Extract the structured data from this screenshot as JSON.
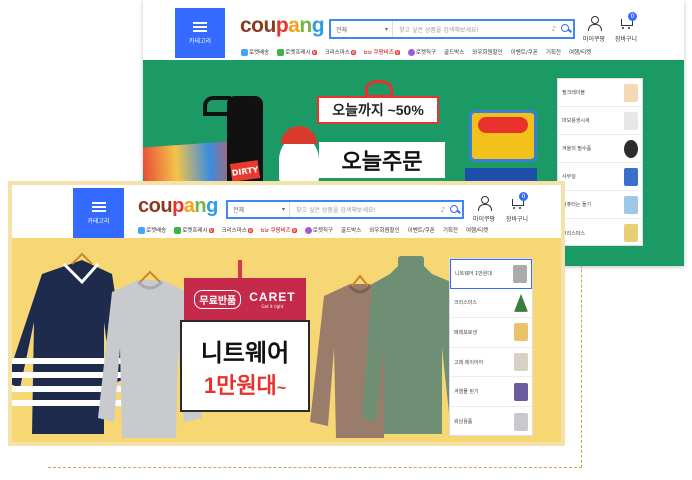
{
  "back": {
    "category_label": "카테고리",
    "logo": [
      "cou",
      "p",
      "a",
      "n",
      "g"
    ],
    "search": {
      "select": "전체",
      "placeholder": "찾고 싶은 상품을 검색해보세요!"
    },
    "mycoupang": "마이쿠팡",
    "cart": {
      "label": "장바구니",
      "count": "0"
    },
    "nav": [
      "로켓배송",
      "로켓프레시",
      "크리스마스",
      "biz 쿠팡비즈",
      "로켓직구",
      "골드박스",
      "와우회원할인",
      "이벤트/쿠폰",
      "기획전",
      "여행/티켓"
    ],
    "promo": {
      "headline": "오늘까지 ~50%",
      "title": "오늘주문"
    },
    "side": [
      "필크레이블",
      "마모용생시세",
      "겨울의 필수품",
      "사무실",
      "컴퓨터는 돌기",
      "크리스마스"
    ]
  },
  "front": {
    "category_label": "카테고리",
    "logo": [
      "cou",
      "p",
      "a",
      "n",
      "g"
    ],
    "search": {
      "select": "전체",
      "placeholder": "찾고 싶은 상품을 검색해보세요!"
    },
    "mycoupang": "마이쿠팡",
    "cart": {
      "label": "장바구니",
      "count": "0"
    },
    "nav": [
      "로켓배송",
      "로켓프레시",
      "크리스마스",
      "biz 쿠팡비즈",
      "로켓직구",
      "골드박스",
      "와우회원할인",
      "이벤트/쿠폰",
      "기획전",
      "여행/티켓"
    ],
    "promo": {
      "badge": "무료반품",
      "brand": "CARET",
      "brand_sub": "Get it right",
      "line1": "니트웨어",
      "line2": "1만원대",
      "tilde": "~"
    },
    "side": [
      "니트웨어 1만원대",
      "크리스마스",
      "메레포로생",
      "고래 레이어어",
      "겨열물 된기",
      "워남용품"
    ]
  },
  "colors": {
    "accent": "#346aff",
    "back_promo": "#1b9a66",
    "front_promo": "#f7d774",
    "sale_red": "#e8322b"
  }
}
